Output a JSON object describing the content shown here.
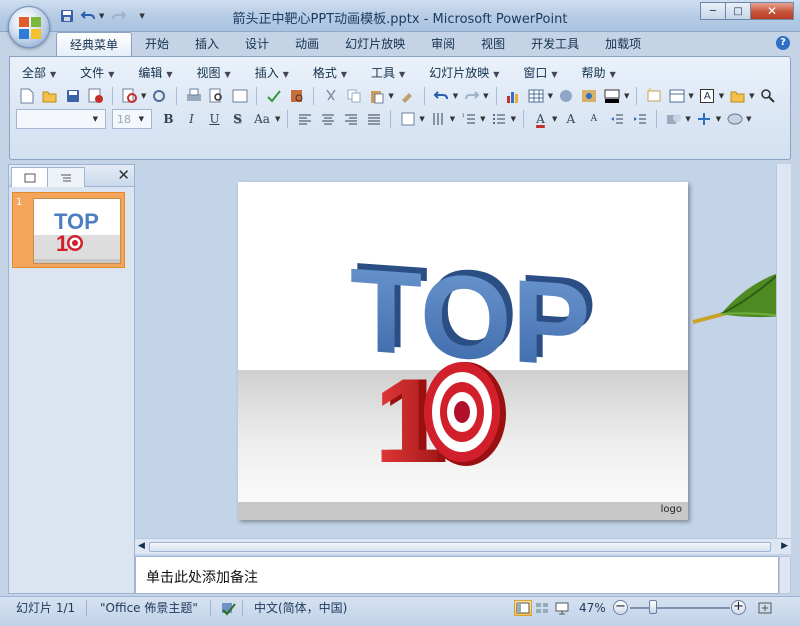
{
  "window": {
    "title": "箭头正中靶心PPT动画模板.pptx - Microsoft PowerPoint",
    "controls": {
      "minimize": "─",
      "maximize": "□",
      "close": "✕"
    }
  },
  "ribbon_tabs": [
    "经典菜单",
    "开始",
    "插入",
    "设计",
    "动画",
    "幻灯片放映",
    "审阅",
    "视图",
    "开发工具",
    "加载项"
  ],
  "active_tab": "经典菜单",
  "classic_menu": [
    "全部",
    "文件",
    "编辑",
    "视图",
    "插入",
    "格式",
    "工具",
    "幻灯片放映",
    "窗口",
    "帮助"
  ],
  "font": {
    "name": "",
    "size": "18"
  },
  "format_buttons": {
    "bold": "B",
    "italic": "I",
    "underline": "U",
    "shadow": "S",
    "change_case": "Aa",
    "grow_font": "A",
    "shrink_font": "A"
  },
  "font_color_label": "A",
  "text_box_label": "A",
  "slides_panel": {
    "close": "✕",
    "slide_number": "1"
  },
  "slide": {
    "title_text": "TOP",
    "number_text": "1",
    "logo_text": "logo"
  },
  "notes": {
    "placeholder": "单击此处添加备注"
  },
  "status_bar": {
    "slide_info": "幻灯片 1/1",
    "theme": "\"Office 佈景主题\"",
    "language": "中文(简体，中国)",
    "zoom": "47%",
    "zoom_level": 0.47,
    "zoom_minus": "−",
    "zoom_plus": "+"
  },
  "colors": {
    "accent_blue": "#4c7fc0",
    "target_red": "#d1202b",
    "arrow_green": "#4e8a22",
    "thumb_selected": "#f4a55c"
  }
}
